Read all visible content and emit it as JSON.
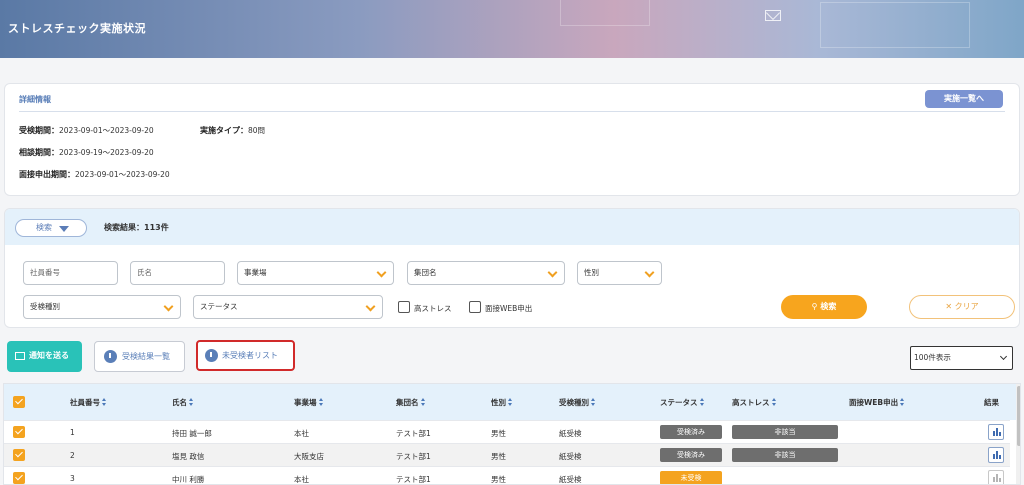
{
  "header": {
    "title": "ストレスチェック実施状況"
  },
  "detail": {
    "section_title": "詳細情報",
    "list_button": "実施一覧へ",
    "exam_period_label": "受検期間：",
    "exam_period_value": "2023-09-01～2023-09-20",
    "type_label": "実施タイプ：",
    "type_value": "80問",
    "consult_period_label": "相談期間：",
    "consult_period_value": "2023-09-19～2023-09-20",
    "interview_period_label": "面接申出期間：",
    "interview_period_value": "2023-09-01～2023-09-20"
  },
  "search": {
    "toggle_label": "検索",
    "result_count": "検索結果：113件",
    "employee_no_placeholder": "社員番号",
    "name_placeholder": "氏名",
    "office_select": "事業場",
    "group_select": "集団名",
    "gender_select": "性別",
    "exam_type_select": "受検種別",
    "status_select": "ステータス",
    "high_stress_label": "高ストレス",
    "interview_web_label": "面接WEB申出",
    "search_button": "検索",
    "clear_button": "クリア"
  },
  "actions": {
    "notify_button": "通知を送る",
    "results_button": "受検結果一覧",
    "unexamined_button": "未受検者リスト",
    "per_page": "100件表示"
  },
  "table": {
    "headers": {
      "employee_no": "社員番号",
      "name": "氏名",
      "office": "事業場",
      "group": "集団名",
      "gender": "性別",
      "exam_type": "受検種別",
      "status": "ステータス",
      "high_stress": "高ストレス",
      "interview_web": "面接WEB申出",
      "result": "結果"
    },
    "rows": [
      {
        "no": "1",
        "name": "持田 誠一郎",
        "office": "本社",
        "group": "テスト部1",
        "gender": "男性",
        "exam_type": "紙受検",
        "status": "受検済み",
        "high_stress": "非該当"
      },
      {
        "no": "2",
        "name": "塩見 政信",
        "office": "大阪支店",
        "group": "テスト部1",
        "gender": "男性",
        "exam_type": "紙受検",
        "status": "受検済み",
        "high_stress": "非該当"
      },
      {
        "no": "3",
        "name": "中川 利勝",
        "office": "本社",
        "group": "テスト部1",
        "gender": "男性",
        "exam_type": "紙受検",
        "status": "未受検",
        "high_stress": ""
      }
    ]
  },
  "icons": [
    "mail-icon",
    "chevron-down-icon",
    "search-icon",
    "close-icon",
    "download-icon",
    "chart-icon",
    "sort-icon",
    "checkbox-checked-icon"
  ],
  "colors": {
    "accent_orange": "#f4a31f",
    "accent_blue": "#5a7fb8",
    "teal": "#29c2b8",
    "highlight_red": "#d12a2a"
  }
}
